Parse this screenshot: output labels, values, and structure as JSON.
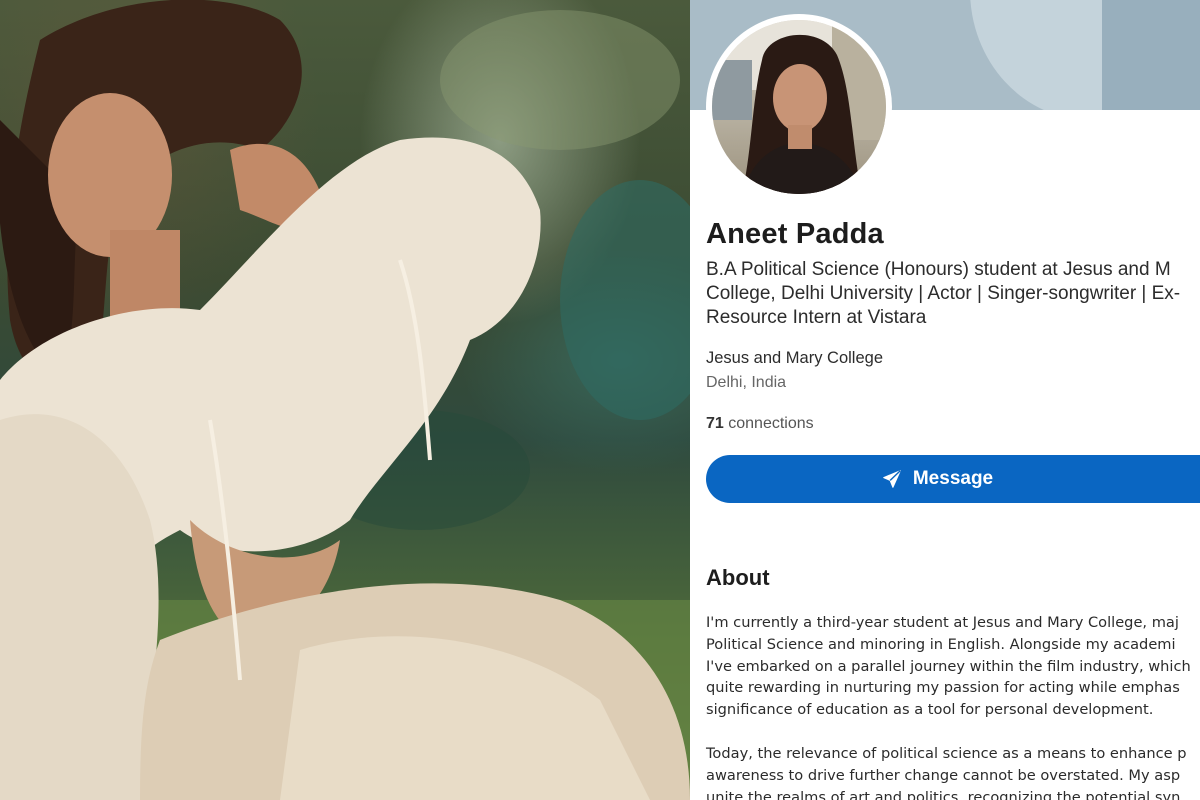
{
  "profile": {
    "name": "Aneet Padda",
    "headline_lines": [
      "B.A Political Science (Honours) student at Jesus and M",
      "College, Delhi University | Actor | Singer-songwriter | Ex-",
      "Resource Intern at Vistara"
    ],
    "organization": "Jesus and Mary College",
    "location": "Delhi, India",
    "connections_count": "71",
    "connections_label": " connections",
    "message_button": "Message"
  },
  "about": {
    "title": "About",
    "paragraph1_lines": [
      "I'm currently a third-year student at Jesus and Mary College, maj",
      "Political Science and minoring in English. Alongside my academi",
      "I've embarked on a parallel journey within the film industry, which",
      "quite rewarding in nurturing my passion for acting while emphas",
      "significance of education as a tool for personal development."
    ],
    "paragraph2_lines": [
      "Today, the relevance of political science as a means to enhance p",
      "awareness to drive further change cannot be overstated. My asp",
      "unite the realms of art and politics, recognizing the potential syn"
    ]
  },
  "colors": {
    "linkedin_blue": "#0a66c2",
    "cover": "#a9bcc7"
  },
  "icons": {
    "message": "paper-plane-icon"
  }
}
